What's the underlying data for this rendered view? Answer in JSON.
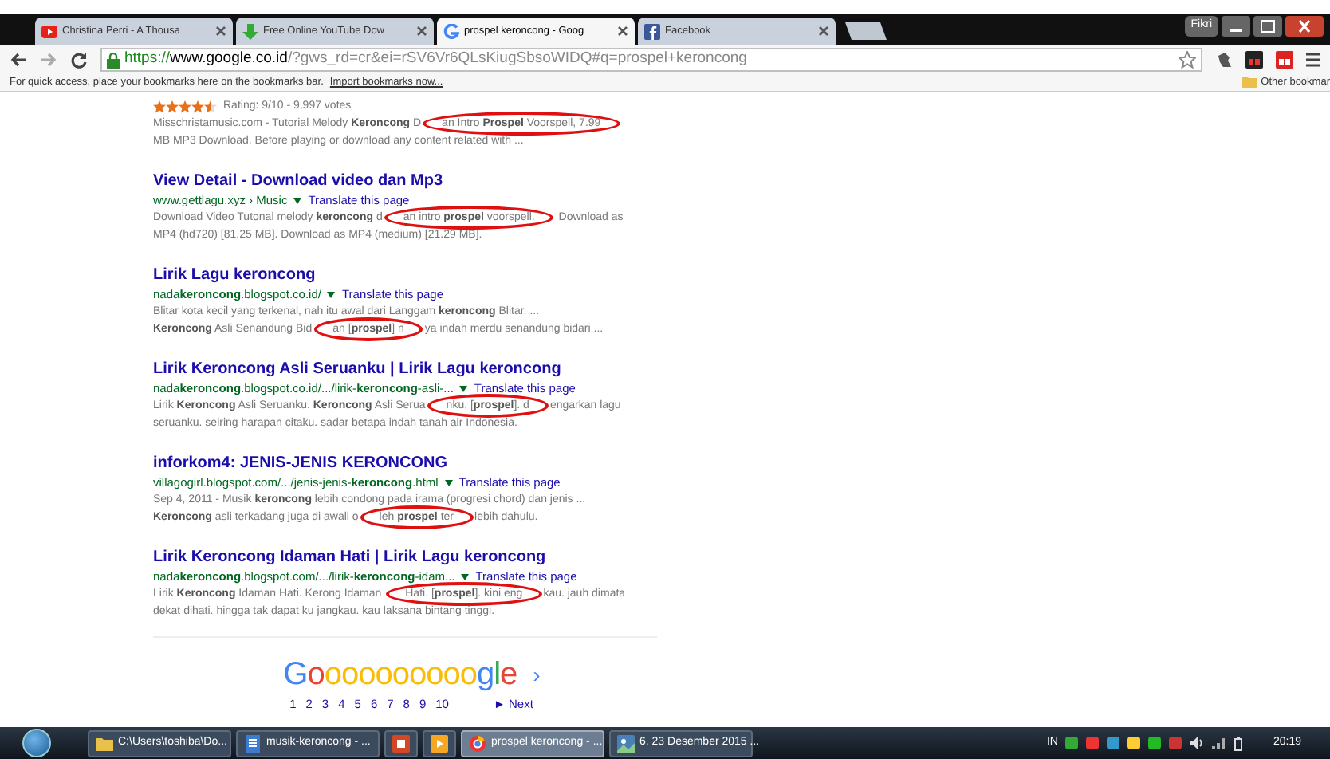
{
  "tabs": [
    {
      "title": "Christina Perri - A Thousa",
      "selected": false
    },
    {
      "title": "Free Online YouTube Dow",
      "selected": false
    },
    {
      "title": "prospel keroncong - Goog",
      "selected": true
    },
    {
      "title": "Facebook",
      "selected": false
    }
  ],
  "user": "Fikri",
  "address": {
    "scheme": "https://",
    "host": "www.google.co.id",
    "path": "/?gws_rd=cr&ei=rSV6Vr6QLsKiugSbsoWIDQ#q=prospel+keroncong"
  },
  "bookmarks_bar": {
    "hint": "For quick access, place your bookmarks here on the bookmarks bar.",
    "link": "Import bookmarks now...",
    "other": "Other bookmar"
  },
  "results": [
    {
      "rating": {
        "stars": 4.5,
        "text": "Rating: 9/10 - 9,997 votes"
      },
      "lines": [
        [
          {
            "text": "Misschristamusic.com - Tutorial Melody **Keroncong** D"
          },
          {
            "text": "an Intro **Prospel** Voorspell, 7.99",
            "circled": true
          }
        ],
        [
          {
            "text": "MB MP3 Download, Before playing or download any content related with ..."
          }
        ]
      ]
    },
    {
      "title": "View Detail - Download video dan Mp3",
      "url": "www.gettlagu.xyz › Music",
      "translate": "Translate this page",
      "lines": [
        [
          {
            "text": "Download Video Tutonal melody **keroncong** d"
          },
          {
            "text": "an intro **prospel** voorspell.",
            "circled": true
          },
          {
            "text": " Download as"
          }
        ],
        [
          {
            "text": "MP4 (hd720) [81.25 MB]. Download as MP4 (medium) [21.29 MB]."
          }
        ]
      ]
    },
    {
      "title": "Lirik Lagu keroncong",
      "url": "nada**keroncong**.blogspot.co.id/",
      "translate": "Translate this page",
      "lines": [
        [
          {
            "text": "Blitar kota kecil yang terkenal, nah itu awal dari Langgam **keroncong** Blitar. ..."
          }
        ],
        [
          {
            "text": "**Keroncong** Asli Senandung Bid"
          },
          {
            "text": "an [**prospel**] n",
            "circled": true
          },
          {
            "text": "ya indah merdu senandung bidari ..."
          }
        ]
      ]
    },
    {
      "title": "Lirik Keroncong Asli Seruanku | Lirik Lagu keroncong",
      "url": "nada**keroncong**.blogspot.co.id/.../lirik-**keroncong**-asli-...",
      "translate": "Translate this page",
      "lines": [
        [
          {
            "text": "Lirik **Keroncong** Asli Seruanku. **Keroncong** Asli Serua"
          },
          {
            "text": "nku. [**prospel**]. d",
            "circled": true
          },
          {
            "text": "engarkan lagu"
          }
        ],
        [
          {
            "text": "seruanku. seiring harapan citaku. sadar betapa indah tanah air Indonesia."
          }
        ]
      ]
    },
    {
      "title": "inforkom4: JENIS-JENIS KERONCONG",
      "url": "villagogirl.blogspot.com/.../jenis-jenis-**keroncong**.html",
      "translate": "Translate this page",
      "lines": [
        [
          {
            "text": "Sep 4, 2011 - Musik **keroncong** lebih condong pada irama (progresi chord) dan jenis ..."
          }
        ],
        [
          {
            "text": "**Keroncong** asli terkadang juga di awali o"
          },
          {
            "text": "leh **prospel** ter",
            "circled": true
          },
          {
            "text": "lebih dahulu."
          }
        ]
      ]
    },
    {
      "title": "Lirik Keroncong Idaman Hati | Lirik Lagu keroncong",
      "url": "nada**keroncong**.blogspot.com/.../lirik-**keroncong**-idam...",
      "translate": "Translate this page",
      "lines": [
        [
          {
            "text": "Lirik **Keroncong** Idaman Hati. Kerong Idaman "
          },
          {
            "text": "Hati. [**prospel**]. kini eng",
            "circled": true
          },
          {
            "text": "kau. jauh dimata"
          }
        ],
        [
          {
            "text": "dekat dihati. hingga tak dapat ku jangkau. kau laksana bintang tinggi."
          }
        ]
      ]
    }
  ],
  "pagination": {
    "logo": [
      {
        "text": "G",
        "color": "#4285f4"
      },
      {
        "text": "o",
        "color": "#ea4335"
      },
      {
        "text": "ooooooooo",
        "color": "#fbbc05"
      },
      {
        "text": "g",
        "color": "#4285f4"
      },
      {
        "text": "l",
        "color": "#34a853"
      },
      {
        "text": "e",
        "color": "#ea4335"
      }
    ],
    "arrow": "›",
    "pages": [
      {
        "label": "1",
        "selected": true
      },
      {
        "label": "2",
        "selected": false
      },
      {
        "label": "3",
        "selected": false
      },
      {
        "label": "4",
        "selected": false
      },
      {
        "label": "5",
        "selected": false
      },
      {
        "label": "6",
        "selected": false
      },
      {
        "label": "7",
        "selected": false
      },
      {
        "label": "8",
        "selected": false
      },
      {
        "label": "9",
        "selected": false
      },
      {
        "label": "10",
        "selected": false
      }
    ],
    "next_glyph": "►",
    "next": "Next"
  },
  "taskbar": {
    "items": [
      {
        "label": "C:\\Users\\toshiba\\Do...",
        "selected": false
      },
      {
        "label": "musik-keroncong - ...",
        "selected": false
      },
      {
        "selected": false
      },
      {
        "selected": false
      },
      {
        "label": "prospel keroncong - ...",
        "selected": true
      },
      {
        "label": "6. 23 Desember 2015 ...",
        "selected": false
      }
    ],
    "language": "IN",
    "clock": "20:19"
  }
}
